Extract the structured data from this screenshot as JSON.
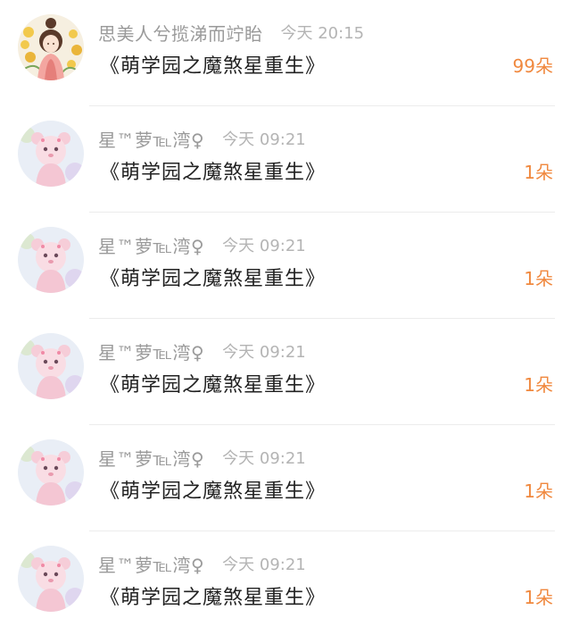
{
  "colors": {
    "username": "#9a9a9a",
    "time": "#b4b4b4",
    "title": "#222222",
    "count": "#f0883e",
    "divider": "#ececec"
  },
  "entries": [
    {
      "avatar_icon": "girl-in-flowers-avatar",
      "username": "思美人兮揽涕而竚眙",
      "time": "今天 20:15",
      "title": "《萌学园之魔煞星重生》",
      "count": "99朵"
    },
    {
      "avatar_icon": "pink-bear-avatar",
      "username": "星™萝℡湾♀",
      "time": "今天 09:21",
      "title": "《萌学园之魔煞星重生》",
      "count": "1朵"
    },
    {
      "avatar_icon": "pink-bear-avatar",
      "username": "星™萝℡湾♀",
      "time": "今天 09:21",
      "title": "《萌学园之魔煞星重生》",
      "count": "1朵"
    },
    {
      "avatar_icon": "pink-bear-avatar",
      "username": "星™萝℡湾♀",
      "time": "今天 09:21",
      "title": "《萌学园之魔煞星重生》",
      "count": "1朵"
    },
    {
      "avatar_icon": "pink-bear-avatar",
      "username": "星™萝℡湾♀",
      "time": "今天 09:21",
      "title": "《萌学园之魔煞星重生》",
      "count": "1朵"
    },
    {
      "avatar_icon": "pink-bear-avatar",
      "username": "星™萝℡湾♀",
      "time": "今天 09:21",
      "title": "《萌学园之魔煞星重生》",
      "count": "1朵"
    }
  ]
}
